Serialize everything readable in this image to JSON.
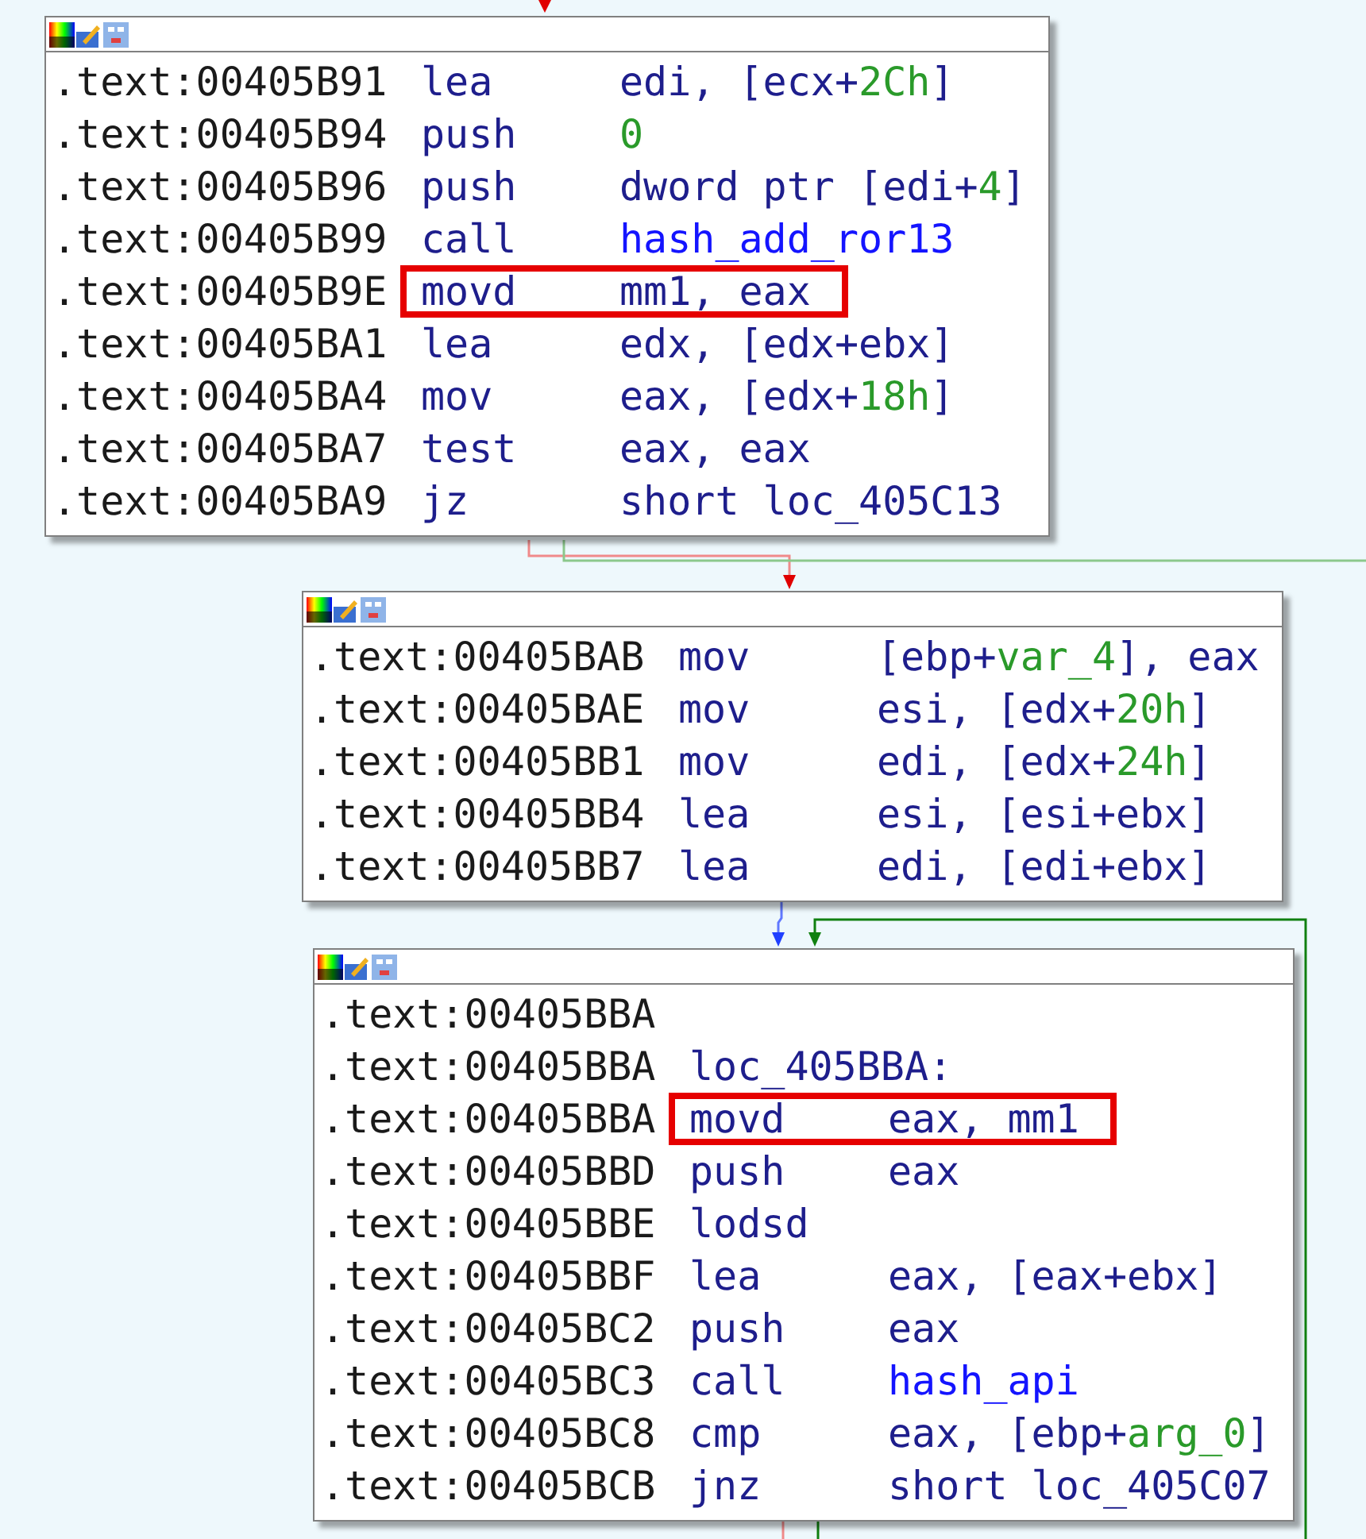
{
  "blocks": [
    {
      "rows": [
        {
          "kind": "instruction",
          "address": ".text:00405B91",
          "mnemonic": "lea",
          "operands": [
            {
              "text": "edi, [ecx+",
              "kind": "reg"
            },
            {
              "text": "2Ch",
              "kind": "num"
            },
            {
              "text": "]",
              "kind": "reg"
            }
          ],
          "highlighted": false
        },
        {
          "kind": "instruction",
          "address": ".text:00405B94",
          "mnemonic": "push",
          "operands": [
            {
              "text": "0",
              "kind": "num"
            }
          ],
          "highlighted": false
        },
        {
          "kind": "instruction",
          "address": ".text:00405B96",
          "mnemonic": "push",
          "operands": [
            {
              "text": "dword ptr [edi+",
              "kind": "reg"
            },
            {
              "text": "4",
              "kind": "num"
            },
            {
              "text": "]",
              "kind": "reg"
            }
          ],
          "highlighted": false
        },
        {
          "kind": "instruction",
          "address": ".text:00405B99",
          "mnemonic": "call",
          "operands": [
            {
              "text": "hash_add_ror13",
              "kind": "func"
            }
          ],
          "highlighted": false
        },
        {
          "kind": "instruction",
          "address": ".text:00405B9E",
          "mnemonic": "movd",
          "operands": [
            {
              "text": "mm1, eax",
              "kind": "reg"
            }
          ],
          "highlighted": true
        },
        {
          "kind": "instruction",
          "address": ".text:00405BA1",
          "mnemonic": "lea",
          "operands": [
            {
              "text": "edx, [edx+ebx]",
              "kind": "reg"
            }
          ],
          "highlighted": false
        },
        {
          "kind": "instruction",
          "address": ".text:00405BA4",
          "mnemonic": "mov",
          "operands": [
            {
              "text": "eax, [edx+",
              "kind": "reg"
            },
            {
              "text": "18h",
              "kind": "num"
            },
            {
              "text": "]",
              "kind": "reg"
            }
          ],
          "highlighted": false
        },
        {
          "kind": "instruction",
          "address": ".text:00405BA7",
          "mnemonic": "test",
          "operands": [
            {
              "text": "eax, eax",
              "kind": "reg"
            }
          ],
          "highlighted": false
        },
        {
          "kind": "instruction",
          "address": ".text:00405BA9",
          "mnemonic": "jz",
          "operands": [
            {
              "text": "short loc_405C13",
              "kind": "reg"
            }
          ],
          "highlighted": false
        }
      ]
    },
    {
      "rows": [
        {
          "kind": "instruction",
          "address": ".text:00405BAB",
          "mnemonic": "mov",
          "operands": [
            {
              "text": "[ebp+",
              "kind": "reg"
            },
            {
              "text": "var_4",
              "kind": "num"
            },
            {
              "text": "], eax",
              "kind": "reg"
            }
          ],
          "highlighted": false
        },
        {
          "kind": "instruction",
          "address": ".text:00405BAE",
          "mnemonic": "mov",
          "operands": [
            {
              "text": "esi, [edx+",
              "kind": "reg"
            },
            {
              "text": "20h",
              "kind": "num"
            },
            {
              "text": "]",
              "kind": "reg"
            }
          ],
          "highlighted": false
        },
        {
          "kind": "instruction",
          "address": ".text:00405BB1",
          "mnemonic": "mov",
          "operands": [
            {
              "text": "edi, [edx+",
              "kind": "reg"
            },
            {
              "text": "24h",
              "kind": "num"
            },
            {
              "text": "]",
              "kind": "reg"
            }
          ],
          "highlighted": false
        },
        {
          "kind": "instruction",
          "address": ".text:00405BB4",
          "mnemonic": "lea",
          "operands": [
            {
              "text": "esi, [esi+ebx]",
              "kind": "reg"
            }
          ],
          "highlighted": false
        },
        {
          "kind": "instruction",
          "address": ".text:00405BB7",
          "mnemonic": "lea",
          "operands": [
            {
              "text": "edi, [edi+ebx]",
              "kind": "reg"
            }
          ],
          "highlighted": false
        }
      ]
    },
    {
      "rows": [
        {
          "kind": "blank",
          "address": ".text:00405BBA"
        },
        {
          "kind": "label",
          "address": ".text:00405BBA",
          "label": "loc_405BBA:"
        },
        {
          "kind": "instruction",
          "address": ".text:00405BBA",
          "mnemonic": "movd",
          "operands": [
            {
              "text": "eax, mm1",
              "kind": "reg"
            }
          ],
          "highlighted": true
        },
        {
          "kind": "instruction",
          "address": ".text:00405BBD",
          "mnemonic": "push",
          "operands": [
            {
              "text": "eax",
              "kind": "reg"
            }
          ],
          "highlighted": false
        },
        {
          "kind": "instruction",
          "address": ".text:00405BBE",
          "mnemonic": "lodsd",
          "highlighted": false
        },
        {
          "kind": "instruction",
          "address": ".text:00405BBF",
          "mnemonic": "lea",
          "operands": [
            {
              "text": "eax, [eax+ebx]",
              "kind": "reg"
            }
          ],
          "highlighted": false
        },
        {
          "kind": "instruction",
          "address": ".text:00405BC2",
          "mnemonic": "push",
          "operands": [
            {
              "text": "eax",
              "kind": "reg"
            }
          ],
          "highlighted": false
        },
        {
          "kind": "instruction",
          "address": ".text:00405BC3",
          "mnemonic": "call",
          "operands": [
            {
              "text": "hash_api",
              "kind": "func"
            }
          ],
          "highlighted": false
        },
        {
          "kind": "instruction",
          "address": ".text:00405BC8",
          "mnemonic": "cmp",
          "operands": [
            {
              "text": "eax, [ebp+",
              "kind": "reg"
            },
            {
              "text": "arg_0",
              "kind": "num"
            },
            {
              "text": "]",
              "kind": "reg"
            }
          ],
          "highlighted": false
        },
        {
          "kind": "instruction",
          "address": ".text:00405BCB",
          "mnemonic": "jnz",
          "operands": [
            {
              "text": "short loc_405C07",
              "kind": "reg"
            }
          ],
          "highlighted": false
        }
      ]
    }
  ]
}
